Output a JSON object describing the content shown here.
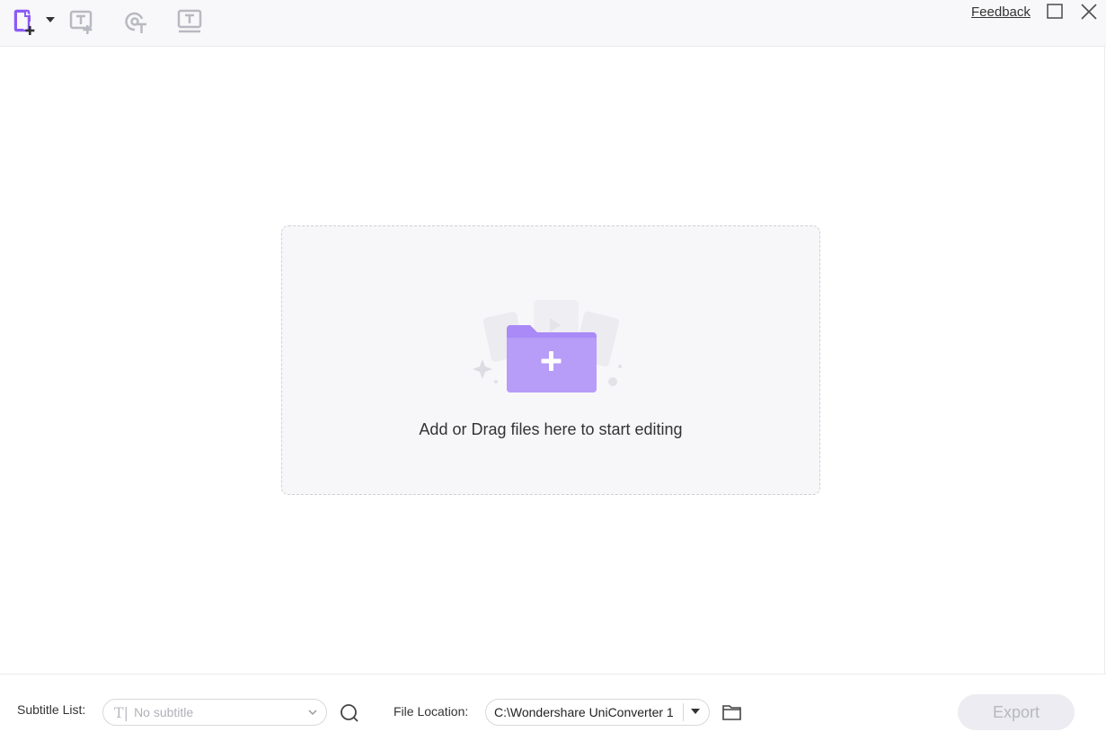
{
  "toolbar": {
    "feedback_label": "Feedback",
    "icons": [
      "add-file-icon",
      "add-subtitle-icon",
      "auto-subtitle-icon",
      "text-to-subtitle-icon"
    ],
    "accent_color": "#8b5cf6",
    "disabled_icon_color": "#b9b9c2"
  },
  "dropzone": {
    "text": "Add or Drag files here to start editing"
  },
  "bottom": {
    "subtitle_list_label": "Subtitle List:",
    "subtitle_placeholder": "No subtitle",
    "file_location_label": "File Location:",
    "file_location_value": "C:\\Wondershare UniConverter 1",
    "export_label": "Export"
  }
}
